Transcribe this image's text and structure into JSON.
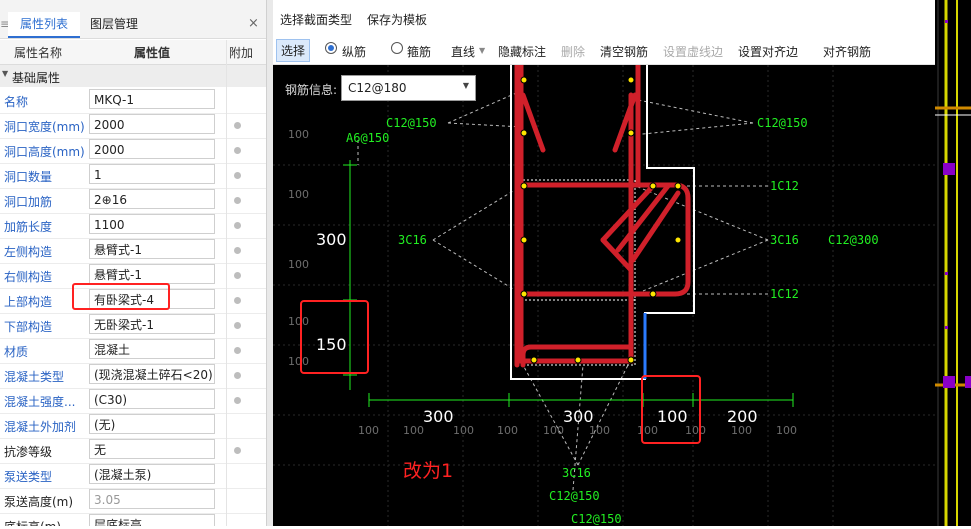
{
  "left_panel": {
    "tabs": {
      "properties": "属性列表",
      "layers": "图层管理",
      "close": "×",
      "grip": "≡"
    },
    "columns": {
      "name": "属性名称",
      "value": "属性值",
      "extra": "附加"
    },
    "section": "基础属性",
    "rows": [
      {
        "name": "名称",
        "value": "MKQ-1",
        "blue": true,
        "dot": false
      },
      {
        "name": "洞口宽度(mm)",
        "value": "2000",
        "blue": true,
        "dot": true
      },
      {
        "name": "洞口高度(mm)",
        "value": "2000",
        "blue": true,
        "dot": true
      },
      {
        "name": "洞口数量",
        "value": "1",
        "blue": true,
        "dot": true
      },
      {
        "name": "洞口加筋",
        "value": "2⊕16",
        "blue": true,
        "dot": true
      },
      {
        "name": "加筋长度",
        "value": "1100",
        "blue": true,
        "dot": true
      },
      {
        "name": "左侧构造",
        "value": "悬臂式-1",
        "blue": true,
        "dot": true
      },
      {
        "name": "右侧构造",
        "value": "悬臂式-1",
        "blue": true,
        "dot": true
      },
      {
        "name": "上部构造",
        "value": "有卧梁式-4",
        "blue": true,
        "dot": true
      },
      {
        "name": "下部构造",
        "value": "无卧梁式-1",
        "blue": true,
        "dot": true
      },
      {
        "name": "材质",
        "value": "混凝土",
        "blue": true,
        "dot": true
      },
      {
        "name": "混凝土类型",
        "value": "(现浇混凝土碎石<20)",
        "blue": true,
        "dot": true
      },
      {
        "name": "混凝土强度...",
        "value": "(C30)",
        "blue": true,
        "dot": true
      },
      {
        "name": "混凝土外加剂",
        "value": "(无)",
        "blue": true,
        "dot": false
      },
      {
        "name": "抗渗等级",
        "value": "无",
        "blue": false,
        "dot": true
      },
      {
        "name": "泵送类型",
        "value": "(混凝土泵)",
        "blue": true,
        "dot": false
      },
      {
        "name": "泵送高度(m)",
        "value": "3.05",
        "blue": false,
        "dot": false,
        "disabled": true
      },
      {
        "name": "底标高(m)",
        "value": "层底标高",
        "blue": false,
        "dot": false
      }
    ]
  },
  "menu": {
    "select_section": "选择截面类型",
    "save_template": "保存为模板"
  },
  "toolbar": {
    "select": "选择",
    "longitudinal": "纵筋",
    "stirrup": "箍筋",
    "line": "直线",
    "hide_labels": "隐藏标注",
    "delete": "删除",
    "clear_rebar": "清空钢筋",
    "set_dashed": "设置虚线边",
    "set_align": "设置对齐边",
    "align_rebar": "对齐钢筋"
  },
  "canvas": {
    "rebar_info_label": "钢筋信息:",
    "rebar_info_value": "C12@180",
    "annotations": {
      "c12_150_a": "C12@150",
      "c12_150_b": "C12@150",
      "a6_150": "A6@150",
      "one_c12_a": "1C12",
      "one_c12_b": "1C12",
      "three_c16_left": "3C16",
      "three_c16_right": "3C16",
      "c12_300": "C12@300",
      "bottom_3c16": "3C16",
      "bottom_c12_150_a": "C12@150",
      "bottom_c12_150_b": "C12@150"
    },
    "dims": {
      "v300": "300",
      "v150": "150",
      "h300a": "300",
      "h300b": "300",
      "h100": "100",
      "h200": "200"
    },
    "grid_label": "100",
    "note": "改为1"
  },
  "colors": {
    "accent": "#2e6fd1",
    "rebar": "#d0202a",
    "annot": "#22ee22",
    "highlight": "#ff2222"
  }
}
